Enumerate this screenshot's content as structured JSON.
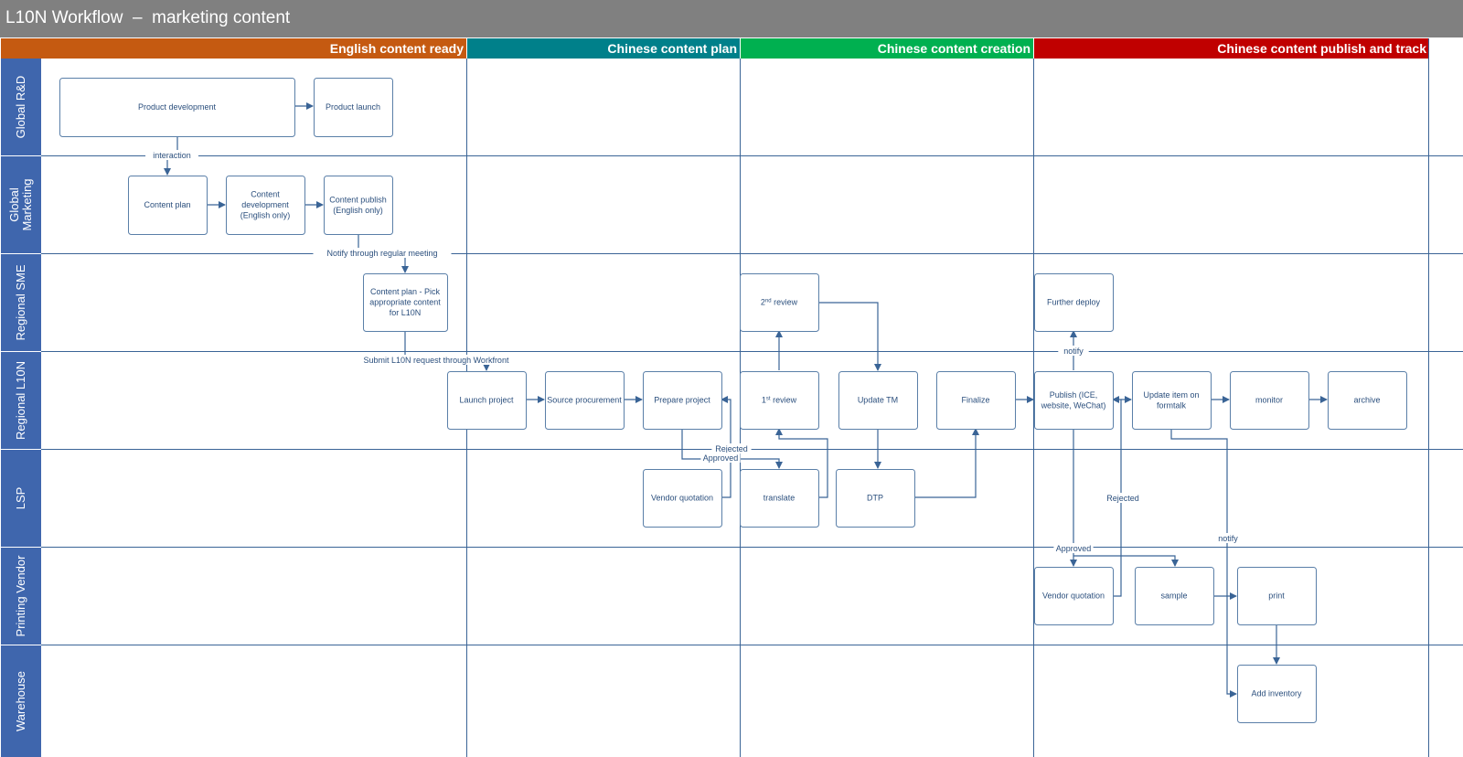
{
  "title": "L10N Workflow  –  marketing content",
  "phases": [
    {
      "label": "English content ready",
      "color": "#c55a11"
    },
    {
      "label": "Chinese content plan",
      "color": "#00808a"
    },
    {
      "label": "Chinese content creation",
      "color": "#00b050"
    },
    {
      "label": "Chinese content publish and track",
      "color": "#c00000"
    }
  ],
  "lanes": [
    {
      "label": "Global R&D"
    },
    {
      "label": "Global\nMarketing"
    },
    {
      "label": "Regional SME"
    },
    {
      "label": "Regional L10N"
    },
    {
      "label": "LSP"
    },
    {
      "label": "Printing Vendor"
    },
    {
      "label": "Warehouse"
    }
  ],
  "nodes": {
    "product_development": "Product development",
    "product_launch": "Product launch",
    "content_plan": "Content plan",
    "content_development": "Content\ndevelopment\n(English only)",
    "content_publish": "Content publish\n(English only)",
    "content_plan_pick": "Content plan - Pick\nappropriate content\nfor L10N",
    "second_review": "2nd review",
    "further_deploy": "Further deploy",
    "launch_project": "Launch project",
    "source_procurement": "Source procurement",
    "prepare_project": "Prepare project",
    "first_review": "1st review",
    "update_tm": "Update TM",
    "finalize": "Finalize",
    "publish": "Publish (ICE,\nwebsite, WeChat)",
    "update_formtalk": "Update item on\nformtalk",
    "monitor": "monitor",
    "archive": "archive",
    "vendor_quotation_lsp": "Vendor quotation",
    "translate": "translate",
    "dtp": "DTP",
    "vendor_quotation_print": "Vendor quotation",
    "sample": "sample",
    "print": "print",
    "add_inventory": "Add inventory"
  },
  "edge_labels": {
    "interaction": "interaction",
    "notify_meeting": "Notify through regular meeting",
    "submit_request": "Submit L10N request through Workfront",
    "rejected_lsp": "Rejected",
    "approved_lsp": "Approved",
    "notify_deploy": "notify",
    "rejected_print": "Rejected",
    "notify_inventory": "notify",
    "approved_print": "Approved"
  },
  "colors": {
    "title_bar": "#808080",
    "lane_header": "#3f66ad",
    "line": "#3a6496",
    "node_border": "#5a7fa8",
    "text": "#2b4f7d"
  }
}
